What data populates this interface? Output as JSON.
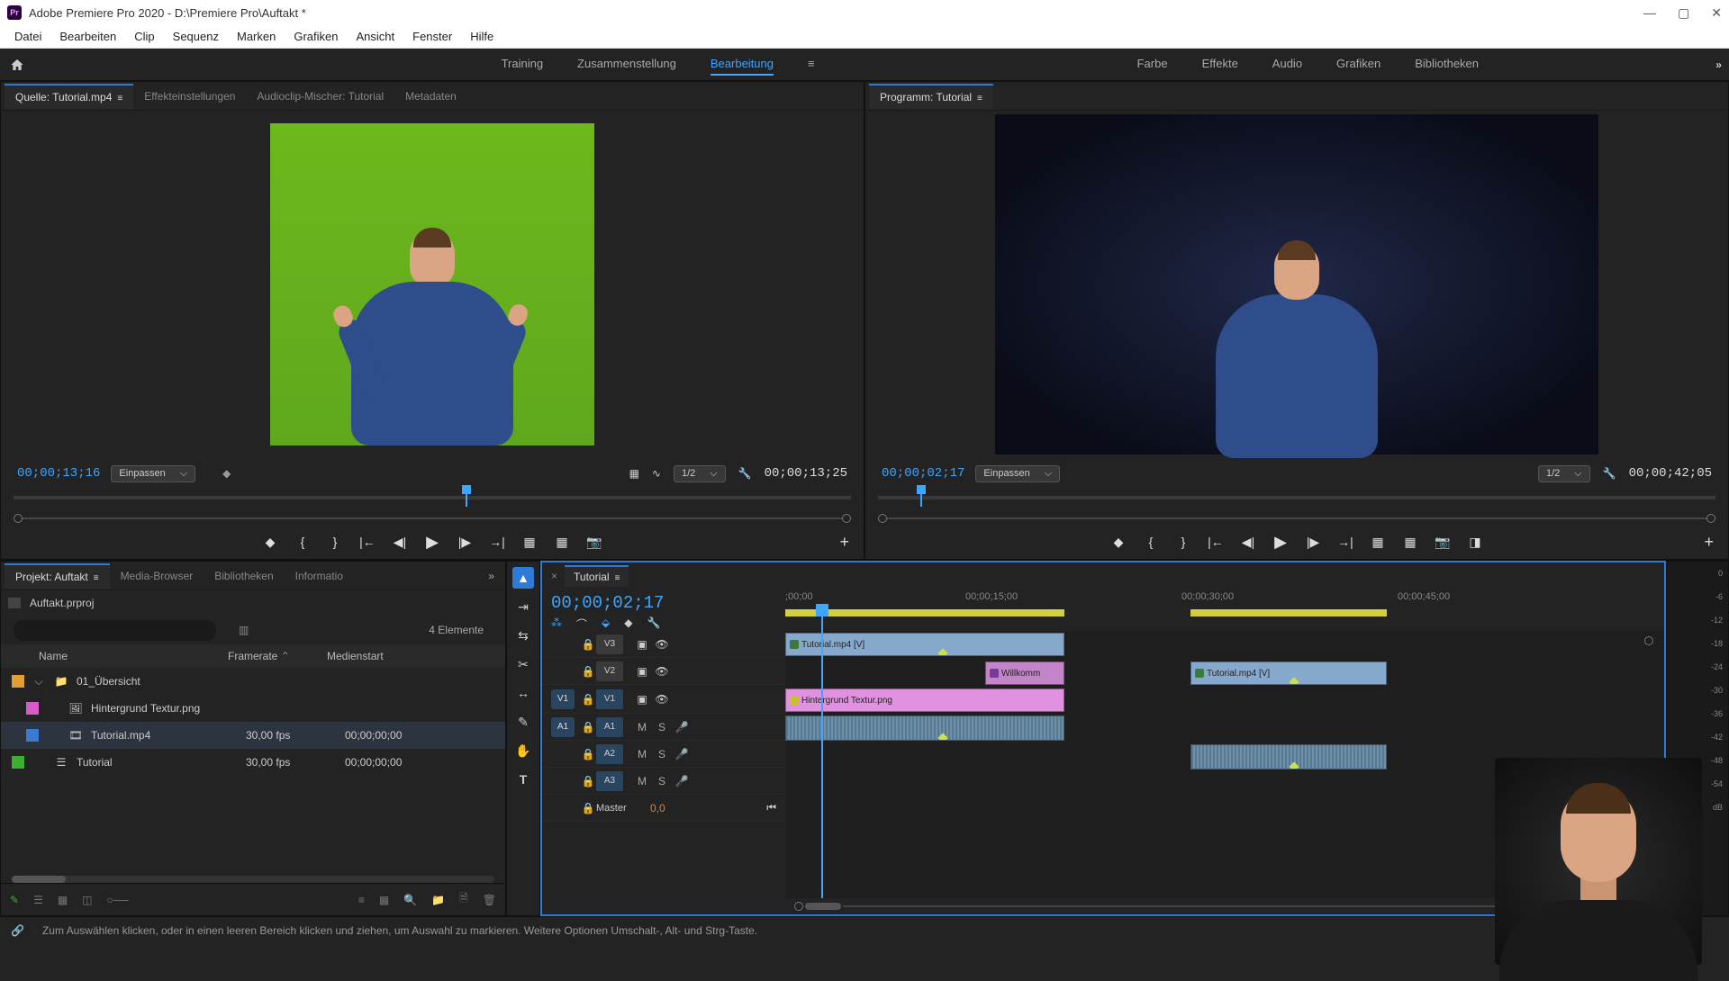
{
  "window": {
    "title": "Adobe Premiere Pro 2020 - D:\\Premiere Pro\\Auftakt *",
    "pr": "Pr"
  },
  "menu": {
    "datei": "Datei",
    "bearbeiten": "Bearbeiten",
    "clip": "Clip",
    "sequenz": "Sequenz",
    "marken": "Marken",
    "grafiken": "Grafiken",
    "ansicht": "Ansicht",
    "fenster": "Fenster",
    "hilfe": "Hilfe"
  },
  "workspaces": {
    "training": "Training",
    "zusammen": "Zusammenstellung",
    "bearb": "Bearbeitung",
    "farbe": "Farbe",
    "effekte": "Effekte",
    "audio": "Audio",
    "grafiken": "Grafiken",
    "biblio": "Bibliotheken"
  },
  "source": {
    "tab": "Quelle: Tutorial.mp4",
    "effekt": "Effekteinstellungen",
    "mixer": "Audioclip-Mischer: Tutorial",
    "meta": "Metadaten",
    "tc": "00;00;13;16",
    "fit": "Einpassen",
    "res": "1/2",
    "dur": "00;00;13;25"
  },
  "program": {
    "tab": "Programm: Tutorial",
    "tc": "00;00;02;17",
    "fit": "Einpassen",
    "res": "1/2",
    "dur": "00;00;42;05"
  },
  "project": {
    "tab": "Projekt: Auftakt",
    "media": "Media-Browser",
    "biblio": "Bibliotheken",
    "info": "Informatio",
    "file": "Auftakt.prproj",
    "elements": "4 Elemente",
    "hdr_name": "Name",
    "hdr_fr": "Framerate",
    "hdr_ms": "Medienstart",
    "bin": "01_Übersicht",
    "it1": "Hintergrund Textur.png",
    "it2": "Tutorial.mp4",
    "fr2": "30,00 fps",
    "ms2": "00;00;00;00",
    "it3": "Tutorial",
    "fr3": "30,00 fps",
    "ms3": "00;00;00;00"
  },
  "timeline": {
    "tab": "Tutorial",
    "tc": "00;00;02;17",
    "r0": ";00;00",
    "r15": "00;00;15;00",
    "r30": "00;00;30;00",
    "r45": "00;00;45;00",
    "v3": "V3",
    "v2": "V2",
    "v1": "V1",
    "a1": "A1",
    "a2": "A2",
    "a3": "A3",
    "master": "Master",
    "mval": "0,0",
    "m": "M",
    "s": "S",
    "clip_v3": "Tutorial.mp4 [V]",
    "clip_v2": "Willkomm",
    "clip_v1": "Hintergrund Textur.png",
    "clip_v2b": "Tutorial.mp4 [V]"
  },
  "meters": {
    "m0": "0",
    "m6": "-6",
    "m12": "-12",
    "m18": "-18",
    "m24": "-24",
    "m30": "-30",
    "m36": "-36",
    "m42": "-42",
    "m48": "-48",
    "m54": "-54",
    "db": "dB"
  },
  "status": {
    "text": "Zum Auswählen klicken, oder in einen leeren Bereich klicken und ziehen, um Auswahl zu markieren. Weitere Optionen Umschalt-, Alt- und Strg-Taste."
  }
}
